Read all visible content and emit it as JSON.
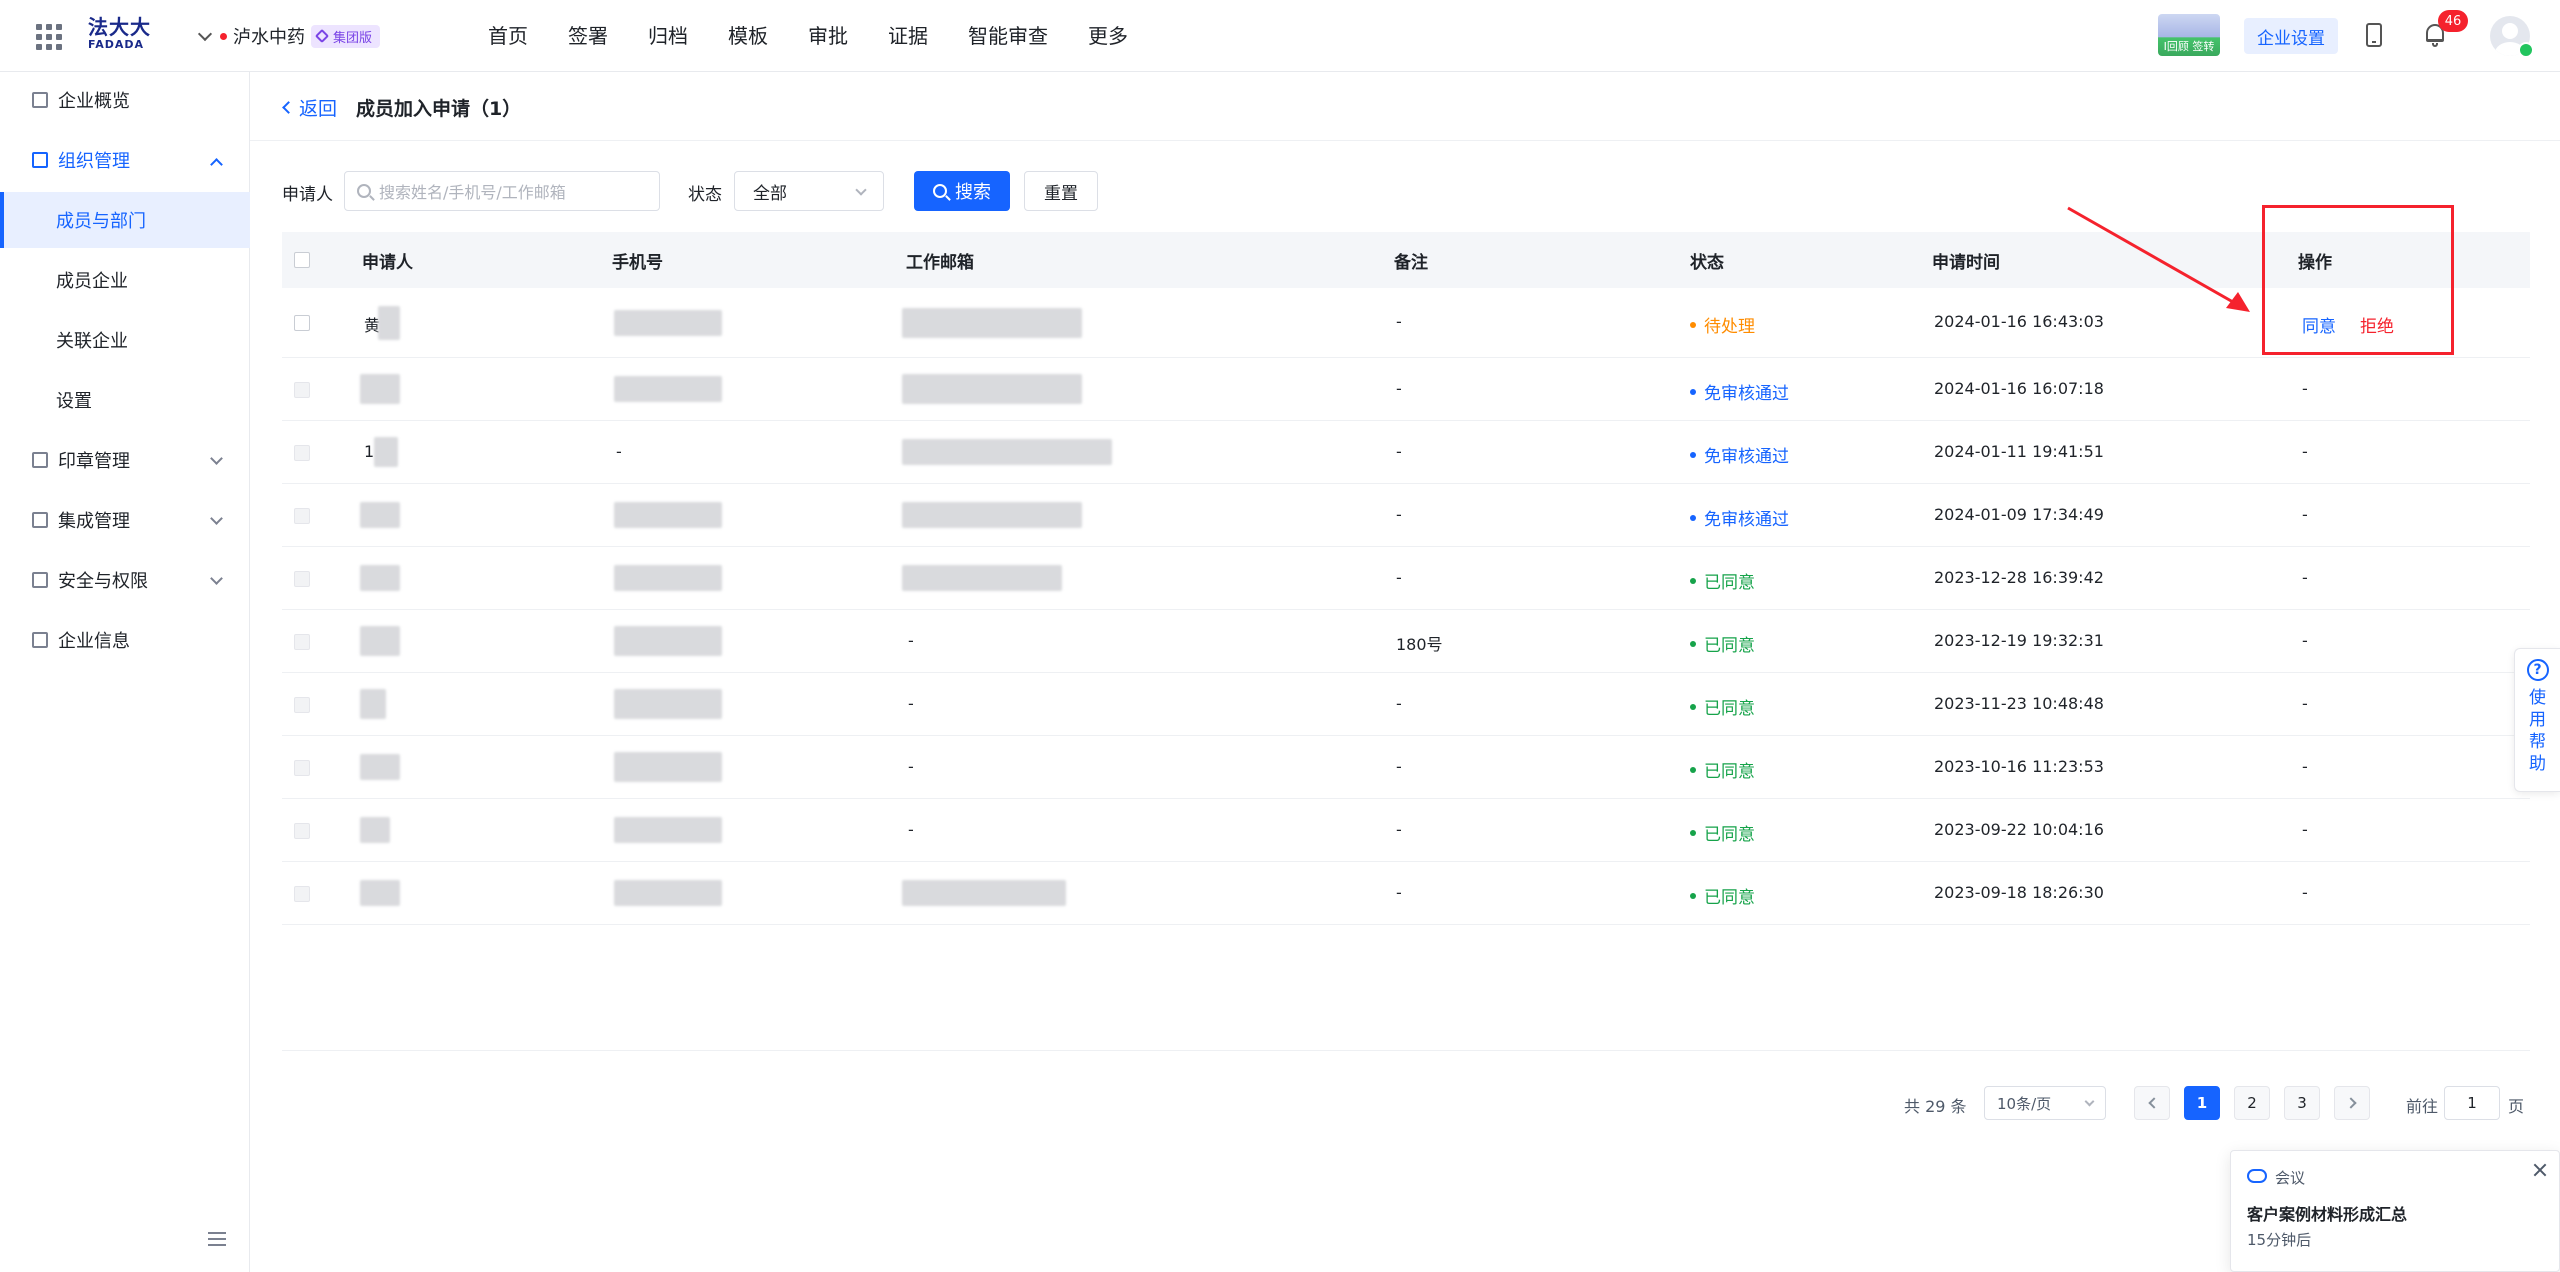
{
  "topbar": {
    "logo_main": "法大大",
    "logo_sub": "FADADA",
    "company": "泸水中药",
    "company_badge": "集团版",
    "nav": [
      "首页",
      "签署",
      "归档",
      "模板",
      "审批",
      "证据",
      "智能审查",
      "更多"
    ],
    "thumb_text": "I回顾 签转",
    "enterprise_settings": "企业设置",
    "notifications": "46"
  },
  "sidebar": {
    "items": [
      {
        "label": "企业概览"
      },
      {
        "label": "组织管理"
      },
      {
        "label": "成员与部门"
      },
      {
        "label": "成员企业"
      },
      {
        "label": "关联企业"
      },
      {
        "label": "设置"
      },
      {
        "label": "印章管理"
      },
      {
        "label": "集成管理"
      },
      {
        "label": "安全与权限"
      },
      {
        "label": "企业信息"
      }
    ]
  },
  "page": {
    "back": "返回",
    "title": "成员加入申请（1）"
  },
  "filters": {
    "applicant_label": "申请人",
    "search_placeholder": "搜索姓名/手机号/工作邮箱",
    "status_label": "状态",
    "status_value": "全部",
    "search_button": "搜索",
    "reset_button": "重置"
  },
  "table": {
    "columns": [
      "申请人",
      "手机号",
      "工作邮箱",
      "备注",
      "状态",
      "申请时间",
      "操作"
    ],
    "rows": [
      {
        "applicant": "黄",
        "phone": "",
        "email": "",
        "note": "-",
        "status": "待处理",
        "time": "2024-01-16 16:43:03",
        "action_agree": "同意",
        "action_reject": "拒绝"
      },
      {
        "applicant": "",
        "phone": "",
        "email": "",
        "note": "-",
        "status": "免审核通过",
        "time": "2024-01-16 16:07:18",
        "action": "-"
      },
      {
        "applicant": "1",
        "phone": "-",
        "email": "",
        "note": "-",
        "status": "免审核通过",
        "time": "2024-01-11 19:41:51",
        "action": "-"
      },
      {
        "applicant": "",
        "phone": "",
        "email": "",
        "note": "-",
        "status": "免审核通过",
        "time": "2024-01-09 17:34:49",
        "action": "-"
      },
      {
        "applicant": "",
        "phone": "",
        "email": "",
        "note": "-",
        "status": "已同意",
        "time": "2023-12-28 16:39:42",
        "action": "-"
      },
      {
        "applicant": "",
        "phone": "",
        "email": "-",
        "note": "180号",
        "status": "已同意",
        "time": "2023-12-19 19:32:31",
        "action": "-"
      },
      {
        "applicant": "",
        "phone": "",
        "email": "-",
        "note": "-",
        "status": "已同意",
        "time": "2023-11-23 10:48:48",
        "action": "-"
      },
      {
        "applicant": "",
        "phone": "",
        "email": "-",
        "note": "-",
        "status": "已同意",
        "time": "2023-10-16 11:23:53",
        "action": "-"
      },
      {
        "applicant": "",
        "phone": "",
        "email": "-",
        "note": "-",
        "status": "已同意",
        "time": "2023-09-22 10:04:16",
        "action": "-"
      },
      {
        "applicant": "",
        "phone": "",
        "email": "",
        "note": "-",
        "status": "已同意",
        "time": "2023-09-18 18:26:30",
        "action": "-"
      }
    ]
  },
  "pagination": {
    "total": "共 29 条",
    "page_size": "10条/页",
    "pages": [
      "1",
      "2",
      "3"
    ],
    "goto_label": "前往",
    "goto_value": "1",
    "page_suffix": "页"
  },
  "help": {
    "label": "使用帮助"
  },
  "popup": {
    "tag": "会议",
    "title": "客户案例材料形成汇总",
    "time": "15分钟后"
  },
  "colors": {
    "primary": "#1664ff",
    "pending": "#ff8c00",
    "approved": "#16a34a",
    "danger": "#f5222d"
  }
}
